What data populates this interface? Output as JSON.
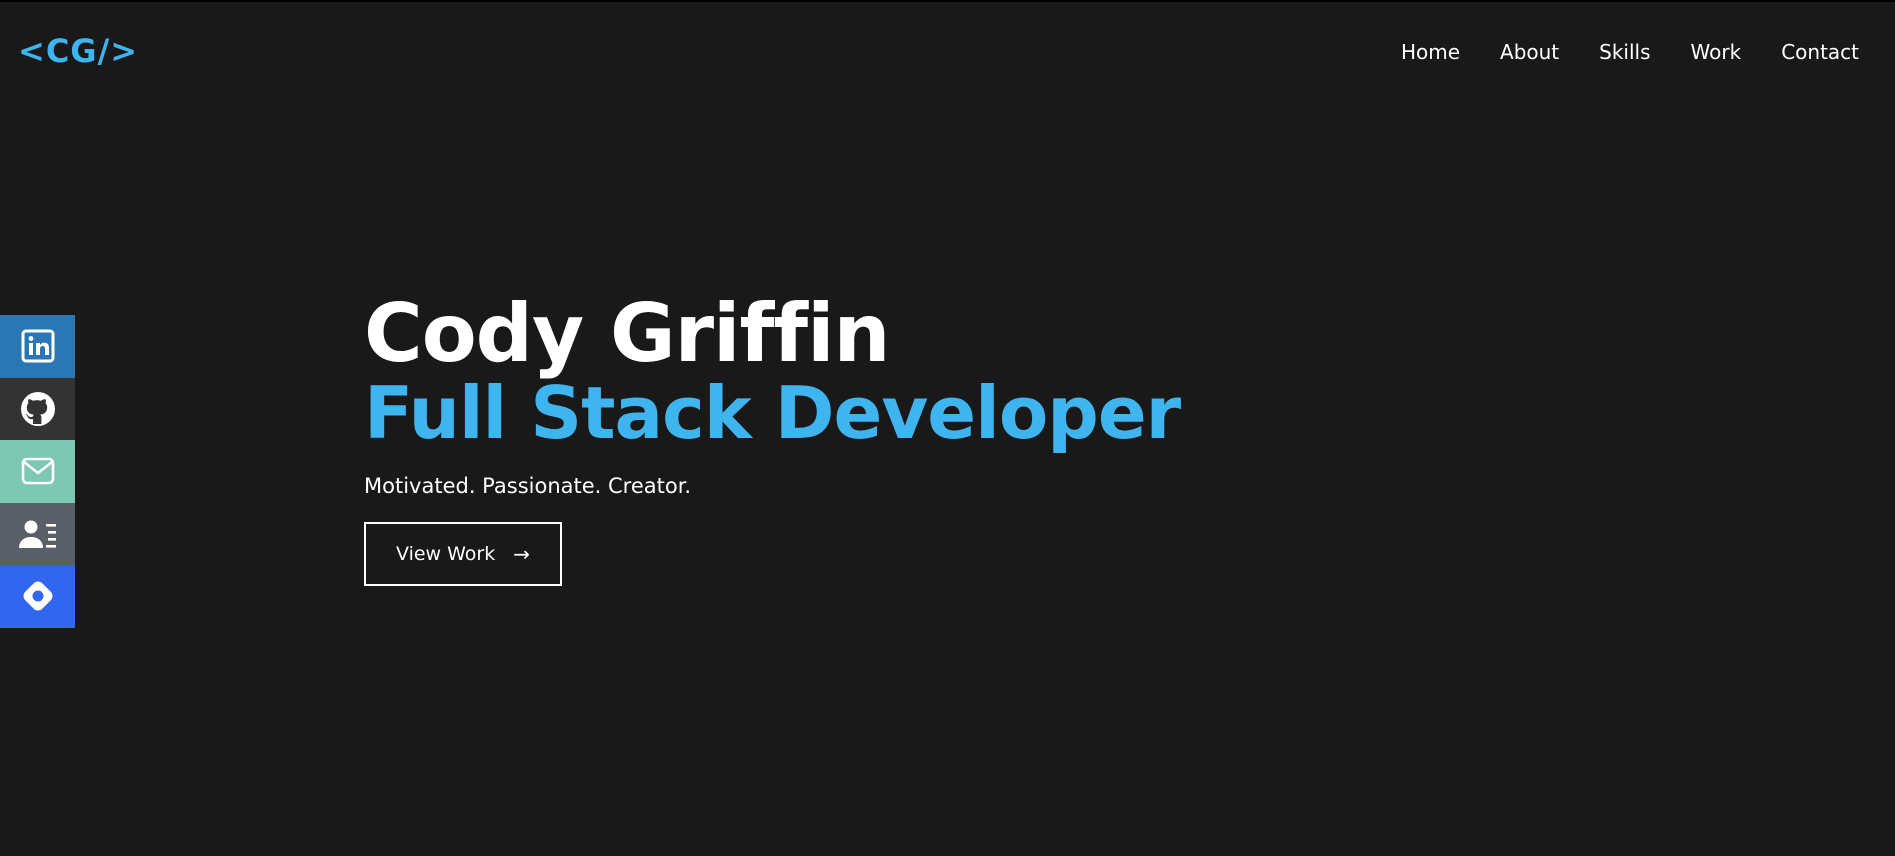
{
  "header": {
    "logo_text": "<CG/>",
    "nav": [
      {
        "label": "Home"
      },
      {
        "label": "About"
      },
      {
        "label": "Skills"
      },
      {
        "label": "Work"
      },
      {
        "label": "Contact"
      }
    ]
  },
  "social": [
    {
      "icon": "linkedin-icon",
      "color": "#2b77b4"
    },
    {
      "icon": "github-icon",
      "color": "#333333"
    },
    {
      "icon": "mail-icon",
      "color": "#7ec7b2"
    },
    {
      "icon": "contact-card-icon",
      "color": "#5a5e66"
    },
    {
      "icon": "diamond-icon",
      "color": "#3366ee"
    }
  ],
  "hero": {
    "name": "Cody Griffin",
    "role": "Full Stack Developer",
    "tagline": "Motivated. Passionate. Creator.",
    "cta_label": "View Work",
    "cta_icon": "arrow-right-icon"
  },
  "colors": {
    "background": "#191919",
    "accent": "#3fb5f0",
    "text": "#ffffff"
  }
}
